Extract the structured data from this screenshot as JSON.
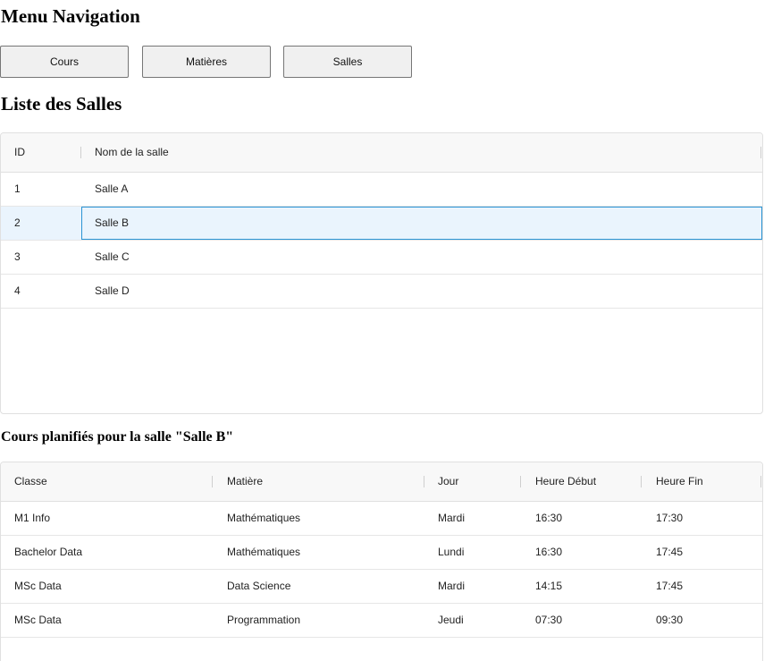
{
  "menu": {
    "title": "Menu Navigation",
    "buttons": [
      "Cours",
      "Matières",
      "Salles"
    ]
  },
  "salles": {
    "title": "Liste des Salles",
    "columns": [
      "ID",
      "Nom de la salle"
    ],
    "rows": [
      {
        "id": "1",
        "name": "Salle A"
      },
      {
        "id": "2",
        "name": "Salle B"
      },
      {
        "id": "3",
        "name": "Salle C"
      },
      {
        "id": "4",
        "name": "Salle D"
      }
    ],
    "selected_row": 1
  },
  "courses": {
    "title": "Cours planifiés pour la salle \"Salle B\"",
    "columns": [
      "Classe",
      "Matière",
      "Jour",
      "Heure Début",
      "Heure Fin"
    ],
    "rows": [
      {
        "classe": "M1 Info",
        "matiere": "Mathématiques",
        "jour": "Mardi",
        "debut": "16:30",
        "fin": "17:30"
      },
      {
        "classe": "Bachelor Data",
        "matiere": "Mathématiques",
        "jour": "Lundi",
        "debut": "16:30",
        "fin": "17:45"
      },
      {
        "classe": "MSc Data",
        "matiere": "Data Science",
        "jour": "Mardi",
        "debut": "14:15",
        "fin": "17:45"
      },
      {
        "classe": "MSc Data",
        "matiere": "Programmation",
        "jour": "Jeudi",
        "debut": "07:30",
        "fin": "09:30"
      }
    ]
  },
  "colors": {
    "selection_border": "#2b94d4",
    "selection_background": "#eaf4fd",
    "button_background": "#f0f0f0"
  }
}
